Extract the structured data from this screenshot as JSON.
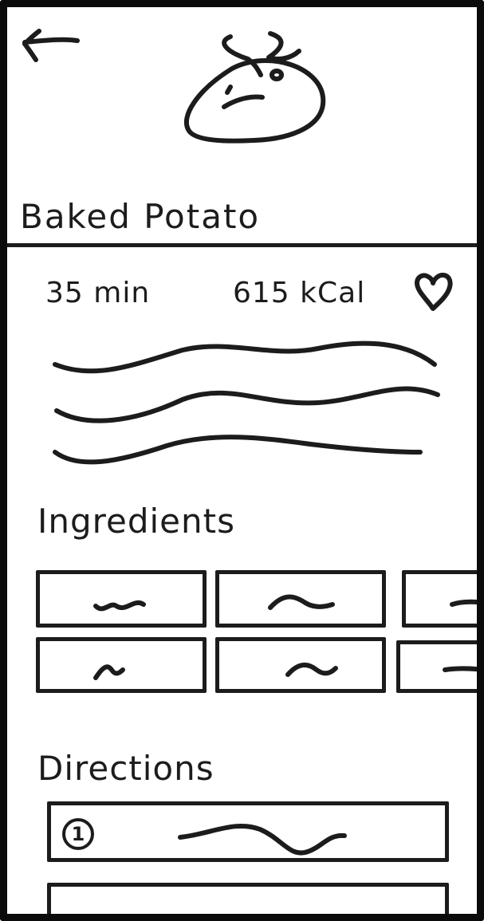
{
  "header": {
    "back_icon": "arrow-left-icon",
    "image_icon": "potato-image-icon"
  },
  "recipe": {
    "title": "Baked Potato",
    "time": "35 min",
    "calories": "615 kCal",
    "favorite_icon": "heart-icon"
  },
  "ingredients": {
    "heading": "Ingredients"
  },
  "directions": {
    "heading": "Directions",
    "steps": [
      {
        "number": "1"
      }
    ]
  }
}
